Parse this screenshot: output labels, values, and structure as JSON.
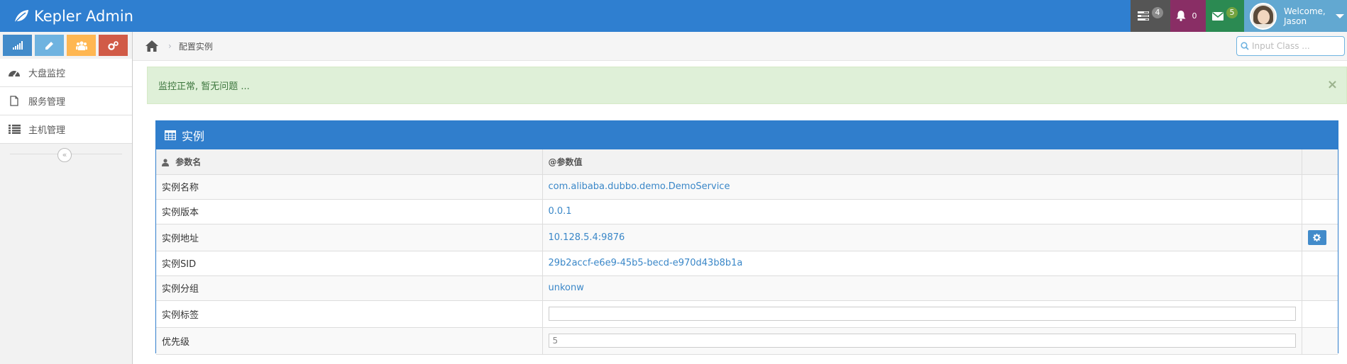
{
  "app": {
    "title": "Kepler Admin"
  },
  "navbar": {
    "tasks_count": "4",
    "notifications_count": "0",
    "messages_count": "5",
    "welcome_line1": "Welcome,",
    "welcome_line2": "Jason"
  },
  "sidebar": {
    "shortcuts": [
      "signal-icon",
      "pencil-icon",
      "group-icon",
      "cogs-icon"
    ],
    "items": [
      {
        "label": "大盘监控",
        "icon": "dashboard-icon"
      },
      {
        "label": "服务管理",
        "icon": "file-icon"
      },
      {
        "label": "主机管理",
        "icon": "list-icon"
      }
    ]
  },
  "breadcrumb": {
    "current": "配置实例"
  },
  "search": {
    "placeholder": "Input Class ..."
  },
  "alert": {
    "text": "监控正常, 暂无问题 ...",
    "close": "×"
  },
  "widget": {
    "title": "实例",
    "headers": {
      "name": "参数名",
      "value": "@参数值"
    },
    "rows": [
      {
        "name": "实例名称",
        "value": "com.alibaba.dubbo.demo.DemoService"
      },
      {
        "name": "实例版本",
        "value": "0.0.1"
      },
      {
        "name": "实例地址",
        "value": "10.128.5.4:9876"
      },
      {
        "name": "实例SID",
        "value": "29b2accf-e6e9-45b5-becd-e970d43b8b1a"
      },
      {
        "name": "实例分组",
        "value": "unkonw"
      },
      {
        "name": "实例标签",
        "value": ""
      },
      {
        "name": "优先级",
        "value": "5"
      }
    ]
  },
  "colors": {
    "navbar": "#2f7fd0",
    "accent": "#307ecc",
    "alert_bg": "#dff0d8",
    "alert_text": "#3c763d",
    "link": "#3a87c8"
  }
}
